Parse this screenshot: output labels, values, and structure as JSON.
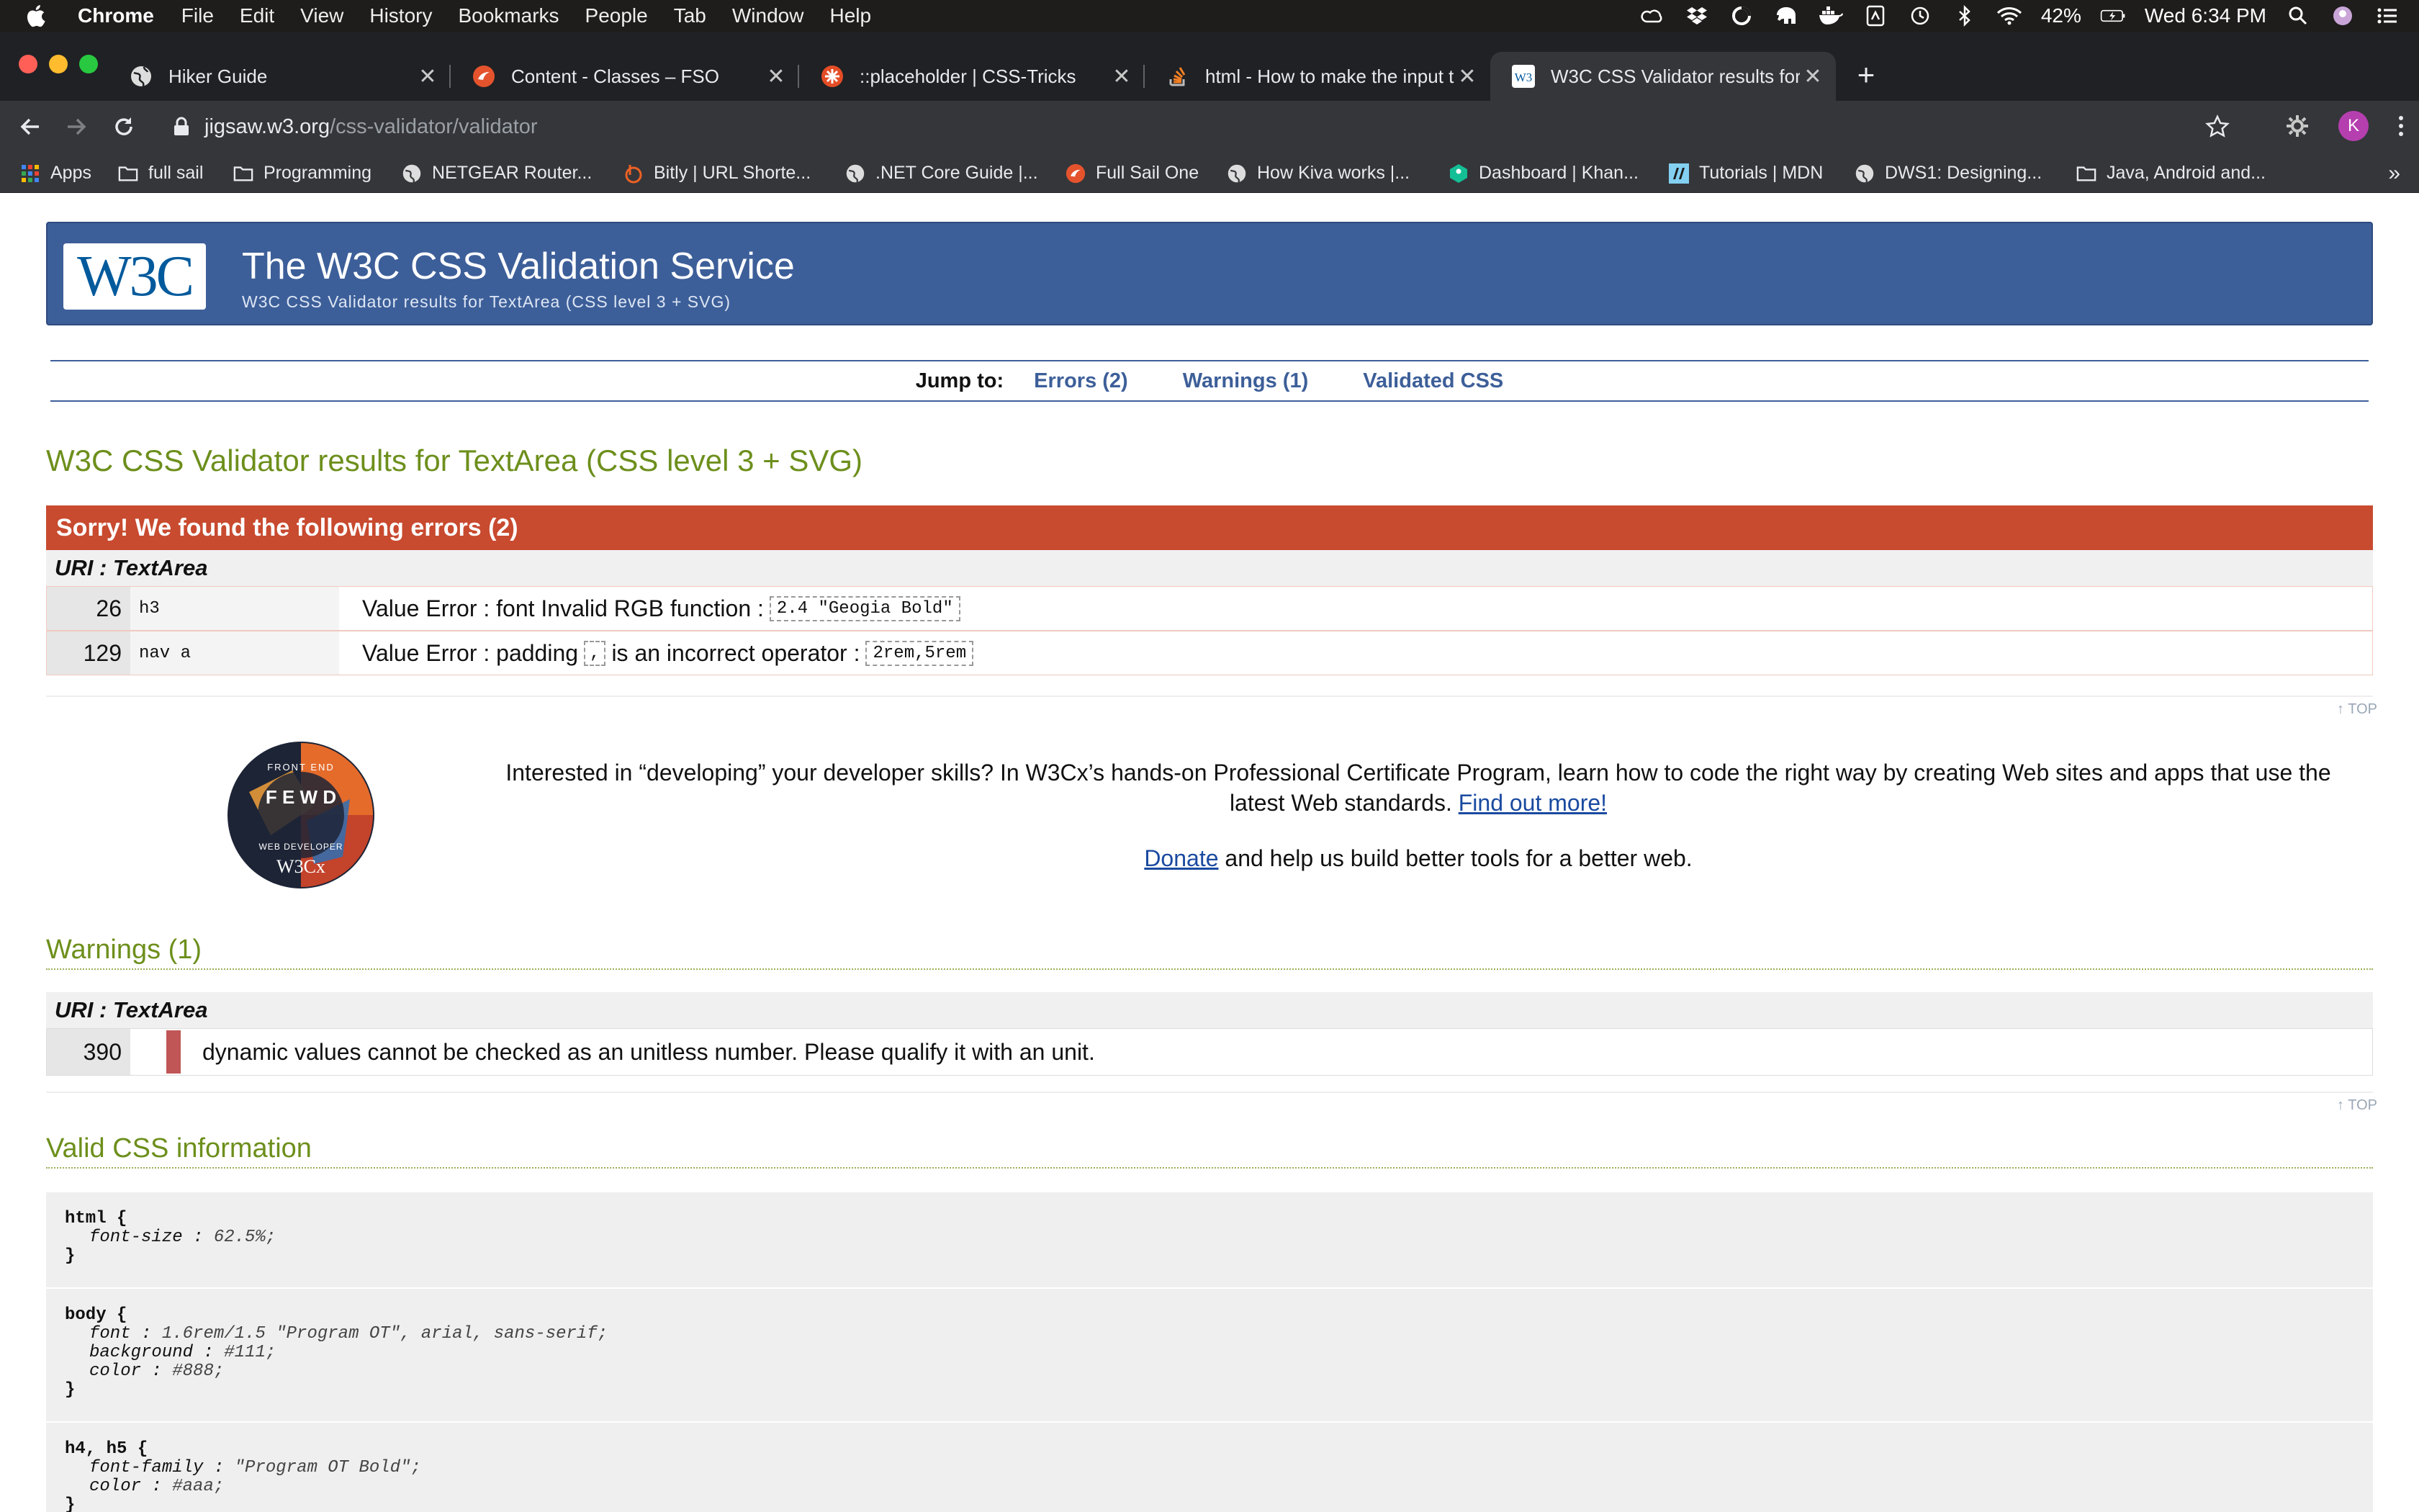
{
  "menubar": {
    "app": "Chrome",
    "items": [
      "File",
      "Edit",
      "View",
      "History",
      "Bookmarks",
      "People",
      "Tab",
      "Window",
      "Help"
    ],
    "battery": "42%",
    "clock": "Wed 6:34 PM"
  },
  "tabs": [
    {
      "title": "Hiker Guide",
      "favicon": "globe-icon",
      "color": "#ffffff",
      "active": false
    },
    {
      "title": "Content - Classes – FSO",
      "favicon": "fullsail-icon",
      "color": "#e5532d",
      "active": false
    },
    {
      "title": "::placeholder | CSS-Tricks",
      "favicon": "csstricks-icon",
      "color": "#e44d26",
      "active": false
    },
    {
      "title": "html - How to make the input t",
      "favicon": "stackoverflow-icon",
      "color": "#f48024",
      "active": false
    },
    {
      "title": "W3C CSS Validator results for",
      "favicon": "w3c-icon",
      "color": "#ffffff",
      "active": true
    }
  ],
  "toolbar": {
    "url_host": "jigsaw.w3.org",
    "url_path": "/css-validator/validator",
    "avatar_letter": "K"
  },
  "bookmarks": [
    {
      "label": "Apps",
      "icon": "apps-grid-icon"
    },
    {
      "label": "full sail",
      "icon": "folder-icon"
    },
    {
      "label": "Programming",
      "icon": "folder-icon"
    },
    {
      "label": "NETGEAR Router...",
      "icon": "globe-icon"
    },
    {
      "label": "Bitly | URL Shorte...",
      "icon": "bitly-icon"
    },
    {
      "label": ".NET Core Guide |...",
      "icon": "globe-icon"
    },
    {
      "label": "Full Sail One",
      "icon": "fullsail-icon"
    },
    {
      "label": "How Kiva works |...",
      "icon": "globe-icon"
    },
    {
      "label": "Dashboard | Khan...",
      "icon": "khan-icon"
    },
    {
      "label": "Tutorials | MDN",
      "icon": "mdn-icon"
    },
    {
      "label": "DWS1: Designing...",
      "icon": "globe-icon"
    },
    {
      "label": "Java, Android and...",
      "icon": "folder-icon"
    }
  ],
  "banner": {
    "logo_text": "W3C",
    "title": "The W3C CSS Validation Service",
    "subtitle": "W3C CSS Validator results for TextArea (CSS level 3 + SVG)"
  },
  "jump": {
    "label": "Jump to:",
    "errors": "Errors (2)",
    "warnings": "Warnings (1)",
    "validated": "Validated CSS"
  },
  "results_title": "W3C CSS Validator results for TextArea (CSS level 3 + SVG)",
  "errors": {
    "header": "Sorry! We found the following errors (2)",
    "uri": "URI : TextArea",
    "rows": [
      {
        "line": "26",
        "context": "h3",
        "message": "Value Error : font Invalid RGB function :",
        "code": "2.4 \"Geogia Bold\""
      },
      {
        "line": "129",
        "context": "nav a",
        "message_a": "Value Error : padding",
        "operator": ",",
        "message_b": "is an incorrect operator :",
        "code": "2rem,5rem"
      }
    ]
  },
  "top_link": "↑ TOP",
  "promo": {
    "text": "Interested in “developing” your developer skills? In W3Cx’s hands-on Professional Certificate Program, learn how to code the right way by creating Web sites and apps that use the latest Web standards.",
    "link": "Find out more!",
    "donate_link": "Donate",
    "donate_text": "and help us build better tools for a better web.",
    "badge_text": "W3Cx",
    "badge_letters": "F E W D",
    "badge_ring_top": "FRONT END",
    "badge_ring_bottom": "WEB DEVELOPER"
  },
  "warnings": {
    "title": "Warnings (1)",
    "uri": "URI : TextArea",
    "rows": [
      {
        "line": "390",
        "message": "dynamic values cannot be checked as an unitless number. Please qualify it with an unit."
      }
    ]
  },
  "valid": {
    "title": "Valid CSS information",
    "blocks": [
      {
        "selector": "html {",
        "props": [
          {
            "name": "font-size",
            "value": "62.5%;"
          }
        ]
      },
      {
        "selector": "body {",
        "props": [
          {
            "name": "font",
            "value": "1.6rem/1.5 \"Program OT\", arial, sans-serif;"
          },
          {
            "name": "background",
            "value": "#111;"
          },
          {
            "name": "color",
            "value": "#888;"
          }
        ]
      },
      {
        "selector": "h4, h5 {",
        "props": [
          {
            "name": "font-family",
            "value": "\"Program OT Bold\";"
          },
          {
            "name": "color",
            "value": "#aaa;"
          }
        ]
      }
    ]
  }
}
